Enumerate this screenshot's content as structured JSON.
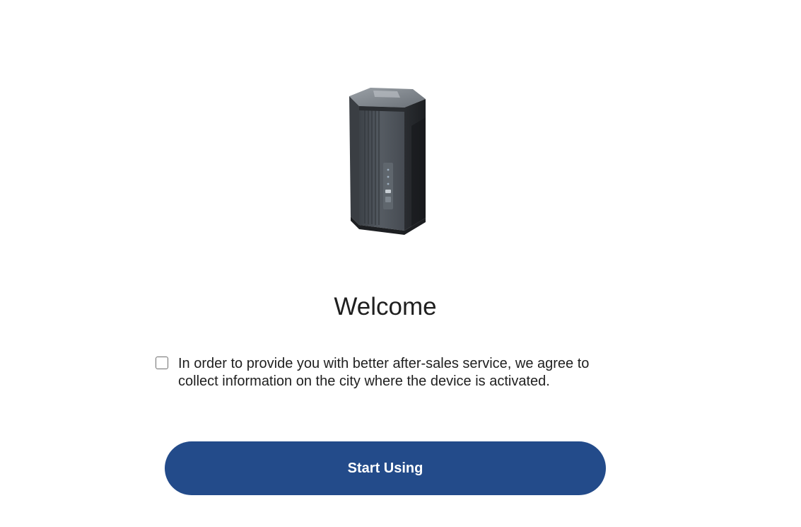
{
  "device": {
    "image_name": "router-device-image"
  },
  "welcome": {
    "title": "Welcome"
  },
  "consent": {
    "checked": false,
    "text": "In order to provide you with better after-sales service, we agree to collect information on the city where the device is activated."
  },
  "actions": {
    "start_label": "Start Using",
    "button_color": "#234b8a"
  }
}
